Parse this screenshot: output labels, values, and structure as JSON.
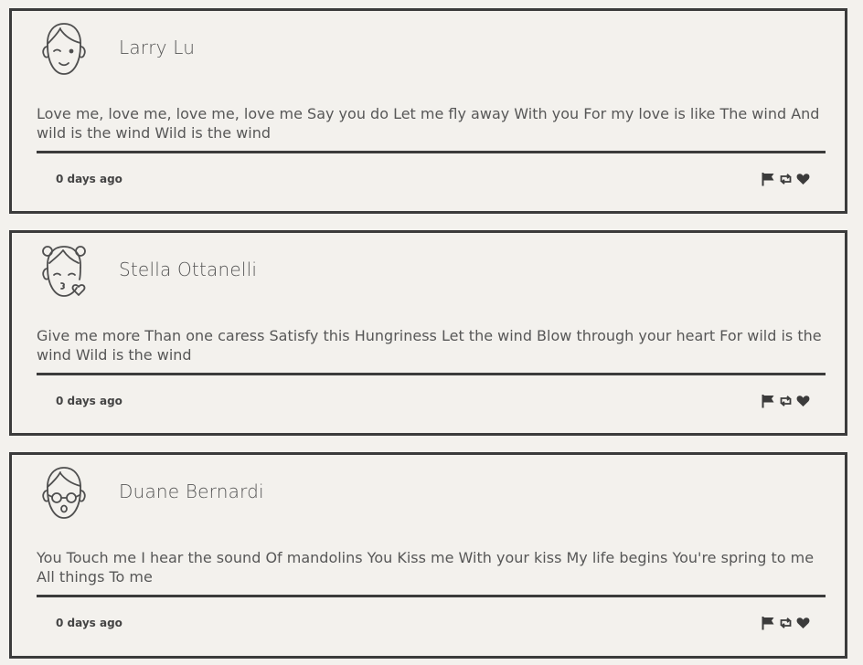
{
  "tweets": [
    {
      "author": "Larry Lu",
      "avatar_icon": "boy-winking-face-icon",
      "text": "Love me, love me, love me, love me Say you do Let me fly away With you For my love is like The wind And wild is the wind Wild is the wind",
      "time": "0 days ago"
    },
    {
      "author": "Stella Ottanelli",
      "avatar_icon": "girl-kissing-face-icon",
      "text": "Give me more Than one caress Satisfy this Hungriness Let the wind Blow through your heart For wild is the wind Wild is the wind",
      "time": "0 days ago"
    },
    {
      "author": "Duane Bernardi",
      "avatar_icon": "boy-glasses-face-icon",
      "text": "You Touch me I hear the sound Of mandolins You Kiss me With your kiss My life begins You're spring to me All things To me",
      "time": "0 days ago"
    }
  ],
  "actions": [
    "flag-icon",
    "retweet-icon",
    "heart-icon"
  ],
  "colors": {
    "background": "#f3f1ed",
    "border": "#3b3b3b",
    "text": "#575757"
  }
}
